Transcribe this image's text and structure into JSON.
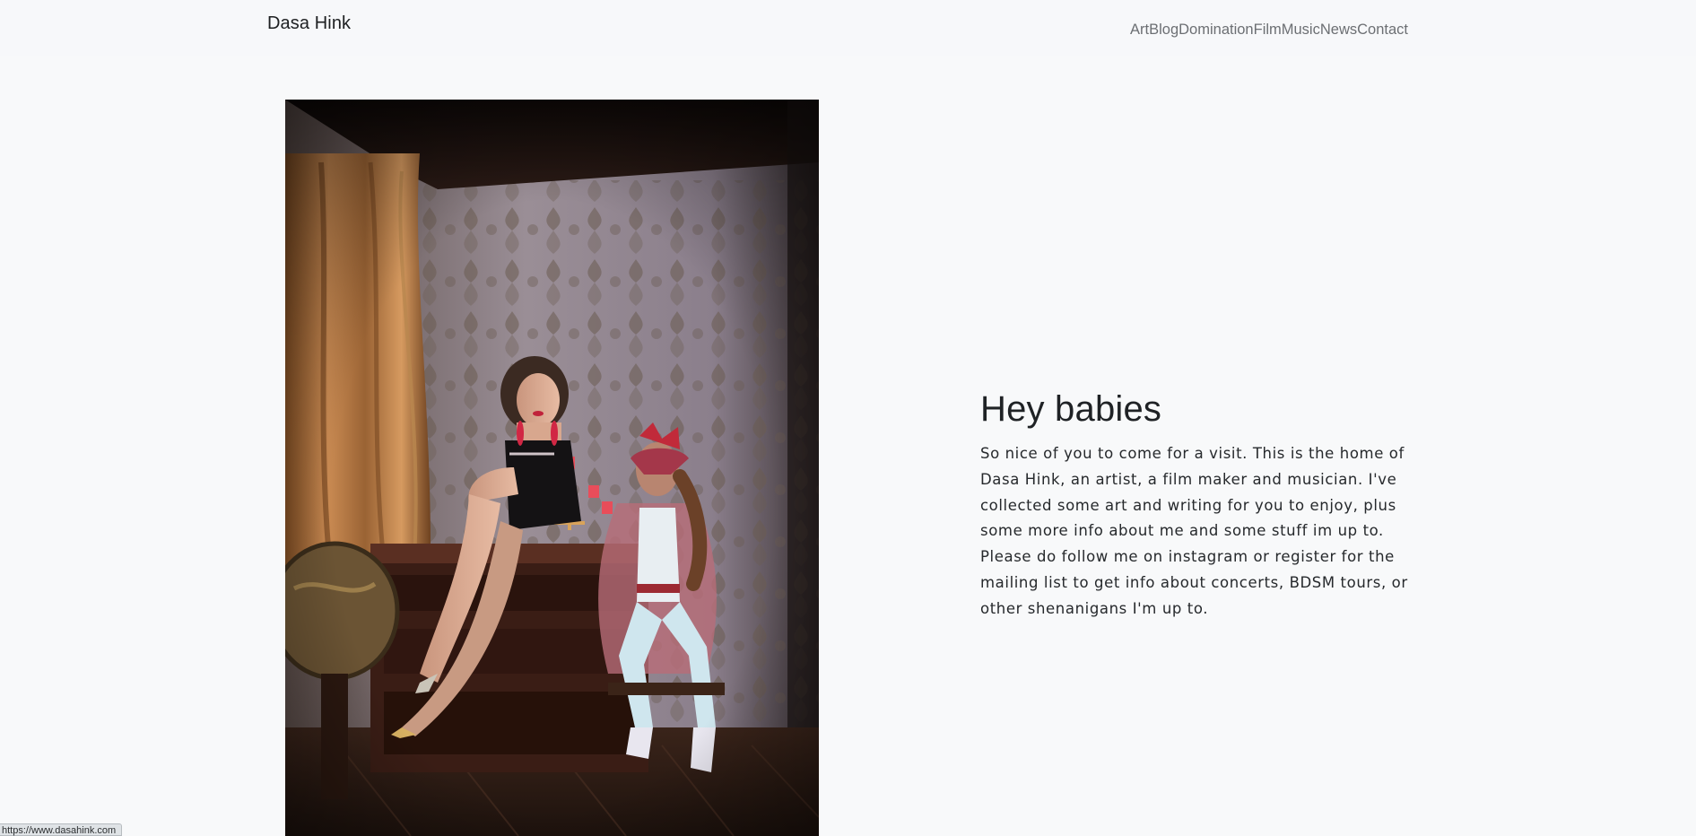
{
  "brand": {
    "name": "Dasa Hink"
  },
  "nav": {
    "items": [
      {
        "label": "Art"
      },
      {
        "label": "Blog"
      },
      {
        "label": "Domination"
      },
      {
        "label": "Film"
      },
      {
        "label": "Music"
      },
      {
        "label": "News"
      },
      {
        "label": "Contact"
      }
    ]
  },
  "hero": {
    "image_icon": "photo-two-women-in-victorian-room-icon"
  },
  "intro": {
    "title": "Hey babies",
    "body": "So nice of you to come for a visit. This is the home of Dasa Hink, an artist, a film maker and musician. I've collected some art and writing for you to enjoy, plus some more info about me and some stuff im up to. Please do follow me on instagram or register for the mailing list to get info about concerts, BDSM tours, or other shenanigans I'm up to."
  },
  "status_bar": {
    "url": "https://www.dasahink.com"
  },
  "colors": {
    "background": "#f8f9fa",
    "nav_text": "#6c6f73",
    "heading_text": "#1f2225"
  }
}
